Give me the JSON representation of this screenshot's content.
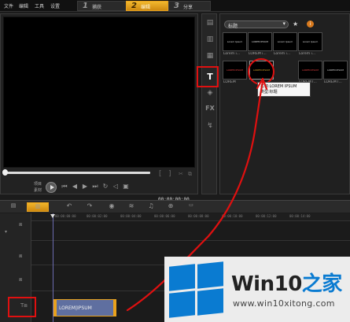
{
  "menu": {
    "items": [
      "文件",
      "编辑",
      "工具",
      "设置"
    ],
    "steps": [
      {
        "num": "1",
        "label": "捕获"
      },
      {
        "num": "2",
        "label": "编辑"
      },
      {
        "num": "3",
        "label": "分享"
      }
    ],
    "active_step": 1
  },
  "player": {
    "mode_top": "项目",
    "mode_bottom": "素材",
    "timecode": "00:00:00:00",
    "progress": 0.0
  },
  "sidebar": {
    "icons": [
      "media-icon",
      "transition-icon",
      "instant-project-icon",
      "title-icon",
      "graphic-icon",
      "filter-icon",
      "path-icon"
    ],
    "active": "title-icon"
  },
  "library": {
    "category": "标题",
    "thumbnails": [
      {
        "text": "Lorem Ipsum",
        "caption": "Lorem i..."
      },
      {
        "text": "LOREM IPSUM",
        "caption": "LOREM i..."
      },
      {
        "text": "Lorem Ipsum",
        "caption": "Lorem i..."
      },
      {
        "text": "Lorem Ipsum",
        "caption": "Lorem i..."
      },
      {
        "text": "LOREM IPSUM",
        "caption": "LOREM"
      },
      {
        "text": "LOREM IPSUM",
        "caption": ""
      },
      {
        "text": "LOREM IPSUM",
        "caption": "LOREM I..."
      },
      {
        "text": "LOREM IPSUM",
        "caption": "LOREM I..."
      }
    ],
    "tooltip_name": "名称:LOREM IPSUM",
    "tooltip_type": "类型:标题"
  },
  "timeline": {
    "ruler": [
      "00:00:00:00",
      "00:00:02:00",
      "00:00:04:00",
      "00:00:06:00",
      "00:00:08:00",
      "00:00:10:00",
      "00:00:12:00",
      "00:00:14:00"
    ],
    "clip_label": "LOREM|IPSUM"
  },
  "watermark": {
    "brand_a": "Win10",
    "brand_b": "之家",
    "url": "www.win10xitong.com"
  },
  "colors": {
    "accent": "#e9a21d",
    "annotation_red": "#e01010",
    "clip_blue": "#5f6fa0",
    "win_blue": "#0a7bd1"
  }
}
